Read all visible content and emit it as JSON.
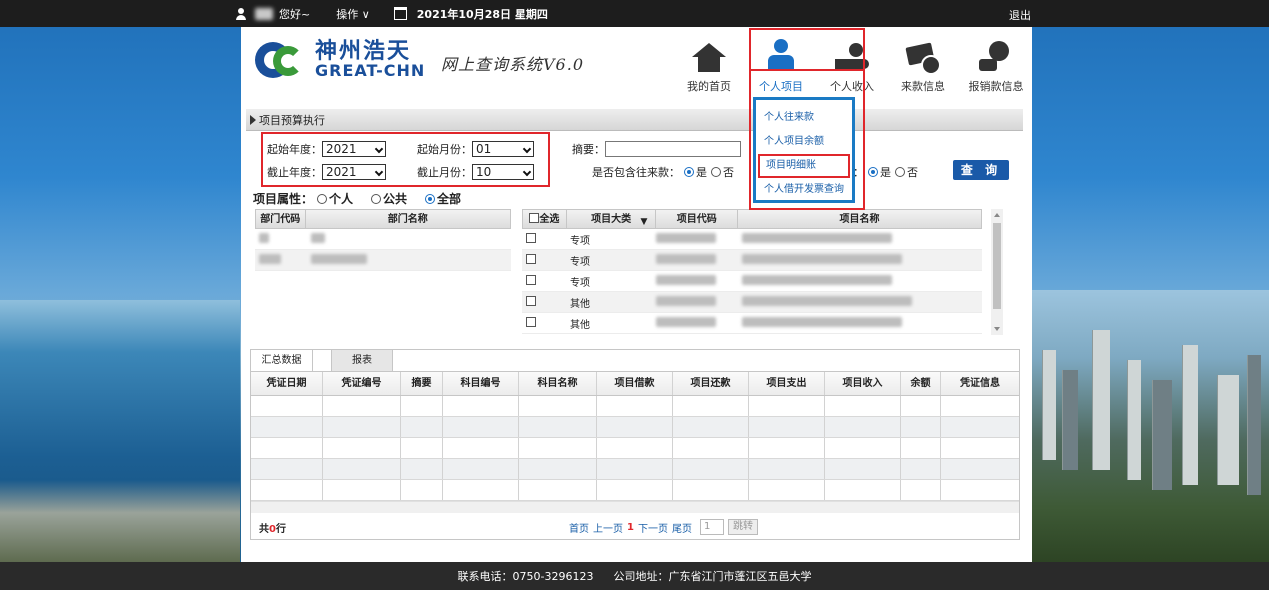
{
  "topbar": {
    "greeting": "您好~",
    "ops_label": "操作 ∨",
    "date": "2021年10月28日 星期四",
    "logout": "退出"
  },
  "header": {
    "logo_cn": "神州浩天",
    "logo_en": "GREAT-CHN",
    "system_title": "网上查询系统V6.0",
    "nav": [
      {
        "label": "我的首页",
        "icon": "home-icon"
      },
      {
        "label": "个人项目",
        "icon": "person-icon",
        "active": true
      },
      {
        "label": "个人收入",
        "icon": "income-hand-icon"
      },
      {
        "label": "来款信息",
        "icon": "money-info-icon"
      },
      {
        "label": "报销款信息",
        "icon": "coins-search-icon"
      }
    ],
    "dropdown": [
      "个人往来款",
      "个人项目余额",
      "项目明细账",
      "个人借开发票查询"
    ]
  },
  "section": {
    "title": "项目预算执行"
  },
  "form": {
    "start_year_label": "起始年度：",
    "start_year": "2021",
    "start_month_label": "起始月份：",
    "start_month": "01",
    "end_year_label": "截止年度：",
    "end_year": "2021",
    "end_month_label": "截止月份：",
    "end_month": "10",
    "summary_label": "摘要：",
    "include_label": "是否包含往来款：",
    "yes": "是",
    "no": "否",
    "colon": "：",
    "query_button": "查 询",
    "attr_label": "项目属性：",
    "attr_personal": "个人",
    "attr_public": "公共",
    "attr_all": "全部"
  },
  "dept_table": {
    "headers": [
      "部门代码",
      "部门名称"
    ]
  },
  "project_table": {
    "select_all": "全选",
    "headers": [
      "项目大类",
      "项目代码",
      "项目名称"
    ],
    "rows": [
      {
        "category": "专项"
      },
      {
        "category": "专项"
      },
      {
        "category": "专项"
      },
      {
        "category": "其他"
      },
      {
        "category": "其他"
      }
    ]
  },
  "bottom": {
    "tabs": [
      "汇总数据",
      "报表"
    ],
    "headers": [
      "凭证日期",
      "凭证编号",
      "摘要",
      "科目编号",
      "科目名称",
      "项目借款",
      "项目还款",
      "项目支出",
      "项目收入",
      "余额",
      "凭证信息"
    ],
    "total_prefix": "共",
    "total_count": "0",
    "total_suffix": "行",
    "pager": {
      "first": "首页",
      "prev": "上一页",
      "current": "1",
      "next": "下一页",
      "last": "尾页",
      "page_input": "1",
      "jump": "跳转"
    }
  },
  "footer": {
    "phone": "联系电话：0750-3296123",
    "address": "公司地址：广东省江门市蓬江区五邑大学"
  }
}
